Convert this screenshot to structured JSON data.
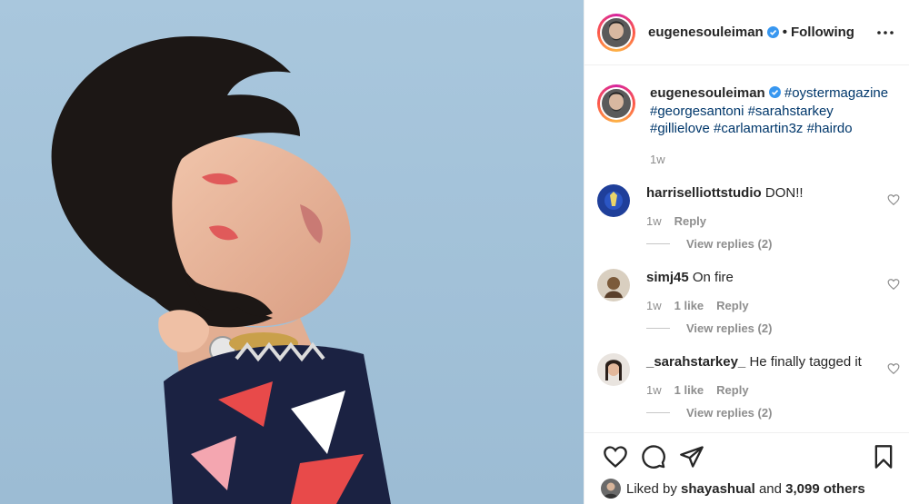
{
  "post": {
    "author": "eugenesouleiman",
    "follow_status": "Following",
    "dot": "•"
  },
  "caption": {
    "username": "eugenesouleiman",
    "hashtags_line1": "#oystermagazine",
    "hashtags_line2": "#georgesantoni #sarahstarkey",
    "hashtags_line3": "#gillielove #carlamartin3z #hairdo",
    "time": "1w"
  },
  "comments": [
    {
      "username": "harriselliottstudio",
      "text": "DON!!",
      "time": "1w",
      "likes": "",
      "reply": "Reply",
      "view_replies": "View replies (2)"
    },
    {
      "username": "simj45",
      "text": "On fire",
      "time": "1w",
      "likes": "1 like",
      "reply": "Reply",
      "view_replies": "View replies (2)"
    },
    {
      "username": "_sarahstarkey_",
      "text": "He finally tagged it",
      "time": "1w",
      "likes": "1 like",
      "reply": "Reply",
      "view_replies": "View replies (2)"
    }
  ],
  "likes": {
    "prefix": "Liked by",
    "user": "shayashual",
    "and": "and",
    "others": "3,099 others"
  },
  "colors": {
    "verified": "#3897f0",
    "hashtag": "#00376b",
    "muted": "#8e8e8e",
    "background_photo": "#9fc0d8"
  },
  "icons": [
    "verified-icon",
    "more-options-icon",
    "heart-icon",
    "comment-icon",
    "share-icon",
    "bookmark-icon"
  ]
}
